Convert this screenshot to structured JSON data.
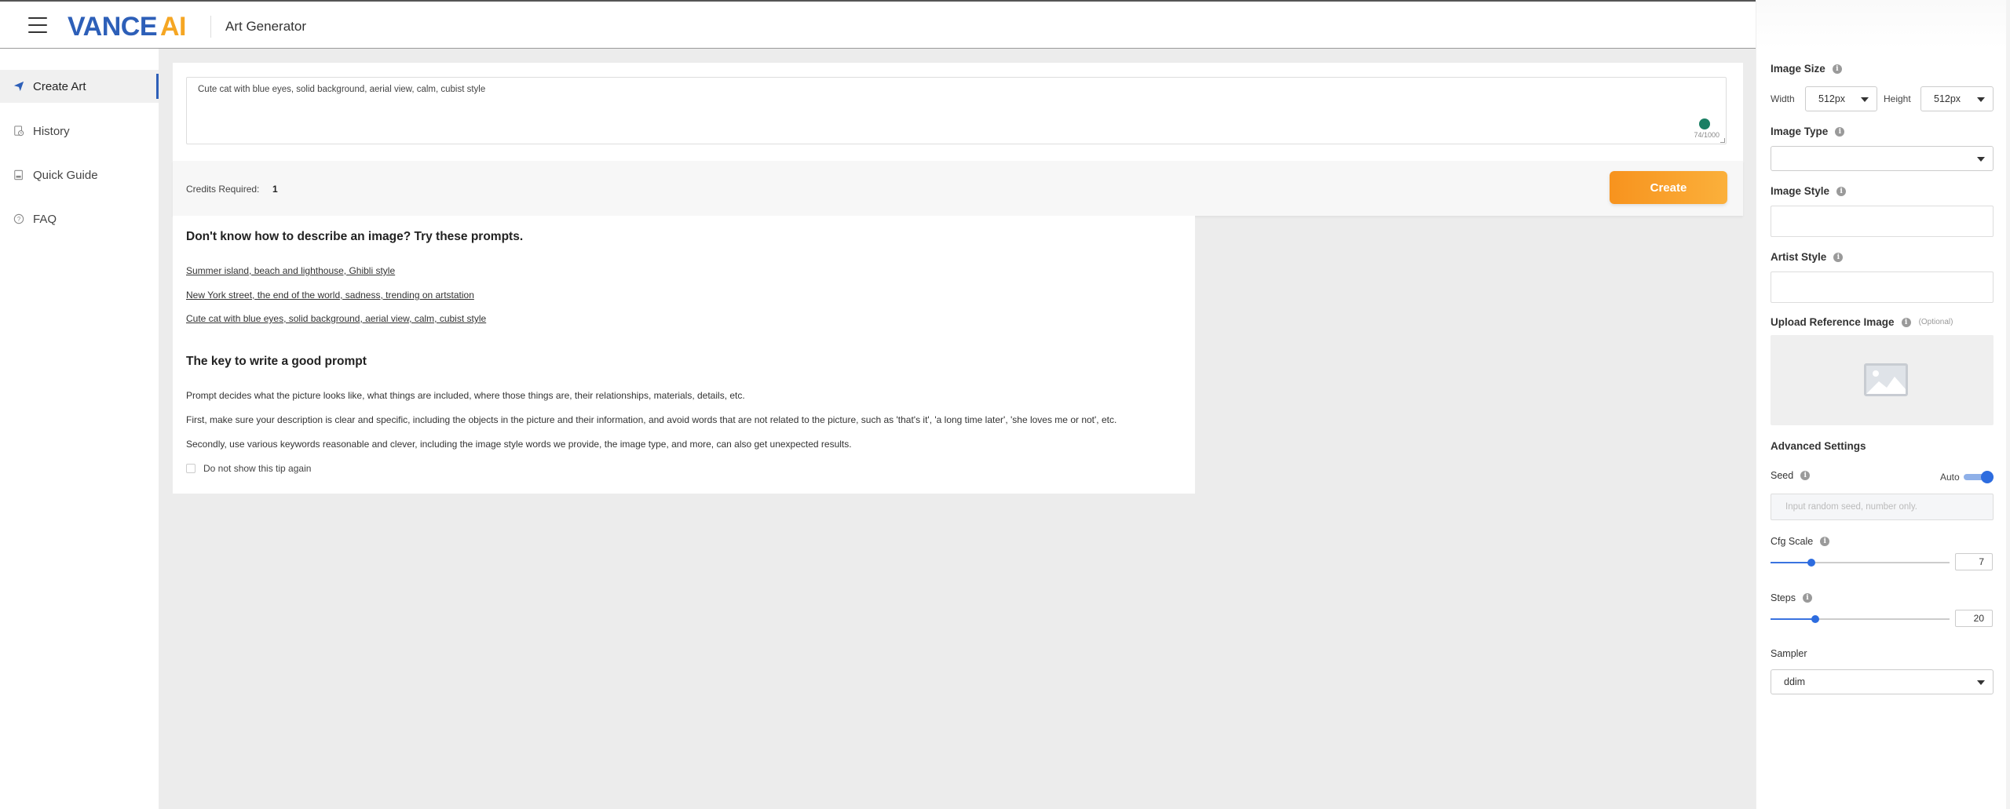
{
  "header": {
    "logo_main": "VANCE",
    "logo_accent": "AI",
    "title": "Art Generator"
  },
  "sidebar": {
    "items": [
      {
        "label": "Create Art",
        "icon": "paper-plane-icon",
        "active": true
      },
      {
        "label": "History",
        "icon": "history-icon",
        "active": false
      },
      {
        "label": "Quick Guide",
        "icon": "book-icon",
        "active": false
      },
      {
        "label": "FAQ",
        "icon": "question-icon",
        "active": false
      }
    ]
  },
  "prompt": {
    "value": "Cute cat with blue eyes, solid background, aerial view, calm, cubist style",
    "counter": "74/1000"
  },
  "credits": {
    "label": "Credits Required:",
    "value": "1",
    "create_label": "Create"
  },
  "tips": {
    "heading1": "Don't know how to describe an image? Try these prompts.",
    "examples": [
      "Summer island, beach and lighthouse, Ghibli style",
      "New York street, the end of the world, sadness, trending on artstation",
      "Cute cat with blue eyes, solid background, aerial view, calm, cubist style"
    ],
    "heading2": "The key to write a good prompt",
    "paragraphs": [
      "Prompt decides what the picture looks like, what things are included, where those things are, their relationships, materials, details, etc.",
      "First, make sure your description is clear and specific, including the objects in the picture and their information, and avoid words that are not related to the picture, such as 'that's it', 'a long time later', 'she loves me or not', etc.",
      "Secondly, use various keywords reasonable and clever, including the image style words we provide, the image type, and more, can also get unexpected results."
    ],
    "dont_show": "Do not show this tip again"
  },
  "settings": {
    "image_size": "Image Size",
    "width_label": "Width",
    "width_value": "512px",
    "height_label": "Height",
    "height_value": "512px",
    "image_type": "Image Type",
    "image_type_value": "",
    "image_style": "Image Style",
    "artist_style": "Artist Style",
    "upload_ref": "Upload Reference Image",
    "optional": "(Optional)",
    "advanced": "Advanced Settings",
    "seed": "Seed",
    "auto": "Auto",
    "auto_enabled": true,
    "seed_placeholder": "Input random seed, number only.",
    "cfg_scale": "Cfg Scale",
    "cfg_value": "7",
    "cfg_fraction": 0.23,
    "steps": "Steps",
    "steps_value": "20",
    "steps_fraction": 0.25,
    "sampler": "Sampler",
    "sampler_value": "ddim"
  },
  "colors": {
    "brand_blue": "#2d5fb8",
    "brand_orange": "#f5a623",
    "create_gradient_start": "#f7931e",
    "create_gradient_end": "#fbb03b",
    "accent": "#2d6cdf"
  }
}
